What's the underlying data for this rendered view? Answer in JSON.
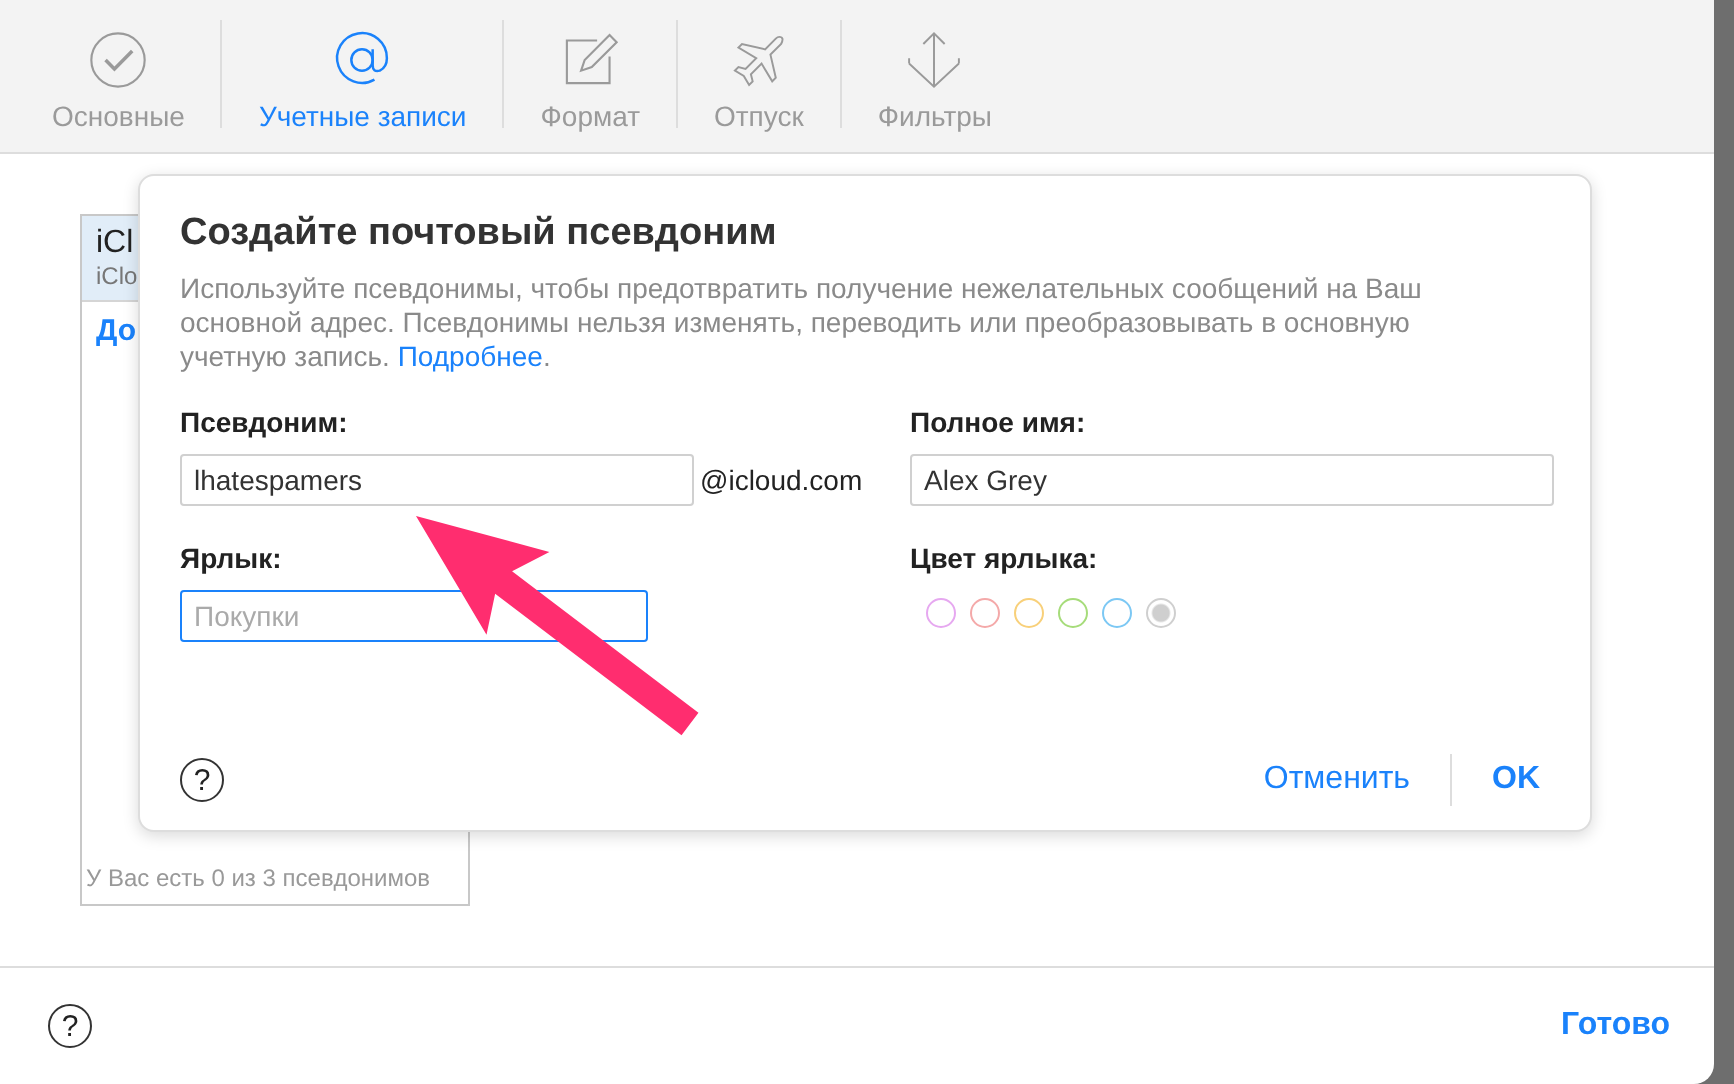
{
  "toolbar": {
    "tabs": [
      {
        "label": "Основные",
        "selected": false
      },
      {
        "label": "Учетные записи",
        "selected": true
      },
      {
        "label": "Формат",
        "selected": false
      },
      {
        "label": "Отпуск",
        "selected": false
      },
      {
        "label": "Фильтры",
        "selected": false
      }
    ]
  },
  "accounts": {
    "items": [
      {
        "title": "iCl",
        "subtitle": "iClo",
        "selected": true
      }
    ],
    "add_link": "До",
    "footer": "У Вас есть 0 из 3 псевдонимов"
  },
  "dialog": {
    "title": "Создайте почтовый псевдоним",
    "description": "Используйте псевдонимы, чтобы предотвратить получение нежелательных сообщений на Ваш основной адрес. Псевдонимы нельзя изменять, переводить или преобразовывать в основную учетную запись.",
    "learn_more": "Подробнее",
    "learn_more_end": ".",
    "alias": {
      "label": "Псевдоним:",
      "value": "lhatespamers",
      "domain": "@icloud.com"
    },
    "full_name": {
      "label": "Полное имя:",
      "value": "Alex Grey"
    },
    "tag": {
      "label": "Ярлык:",
      "placeholder": "Покупки",
      "focused": true
    },
    "tag_color": {
      "label": "Цвет ярлыка:",
      "colors": [
        {
          "color": "#e6a8f0",
          "selected": false
        },
        {
          "color": "#f4a9a9",
          "selected": false
        },
        {
          "color": "#f8d07a",
          "selected": false
        },
        {
          "color": "#a6dc7a",
          "selected": false
        },
        {
          "color": "#7cc8f4",
          "selected": false
        },
        {
          "color": "#cfcfcf",
          "selected": true
        }
      ]
    },
    "help": "?",
    "cancel": "Отменить",
    "ok": "OK"
  },
  "footer": {
    "help": "?",
    "done": "Готово"
  }
}
